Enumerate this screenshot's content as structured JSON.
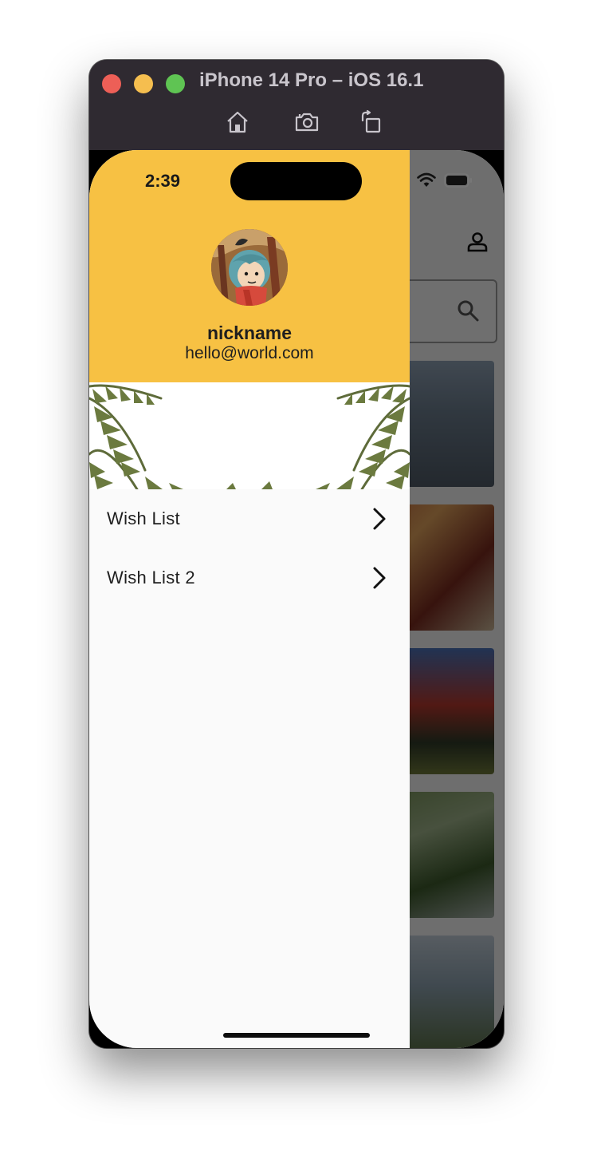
{
  "window": {
    "title": "iPhone 14 Pro – iOS 16.1",
    "toolbar": {
      "home_icon": "home-icon",
      "screenshot_icon": "camera-icon",
      "rotate_icon": "rotate-icon"
    }
  },
  "status_bar": {
    "time": "2:39"
  },
  "drawer": {
    "profile": {
      "nickname": "nickname",
      "email": "hello@world.com"
    },
    "items": [
      {
        "label": "Wish List"
      },
      {
        "label": "Wish List 2"
      }
    ]
  },
  "colors": {
    "header": "#f7c143",
    "drawer_bg": "#fafafa",
    "window_bg": "#2f2a31"
  }
}
